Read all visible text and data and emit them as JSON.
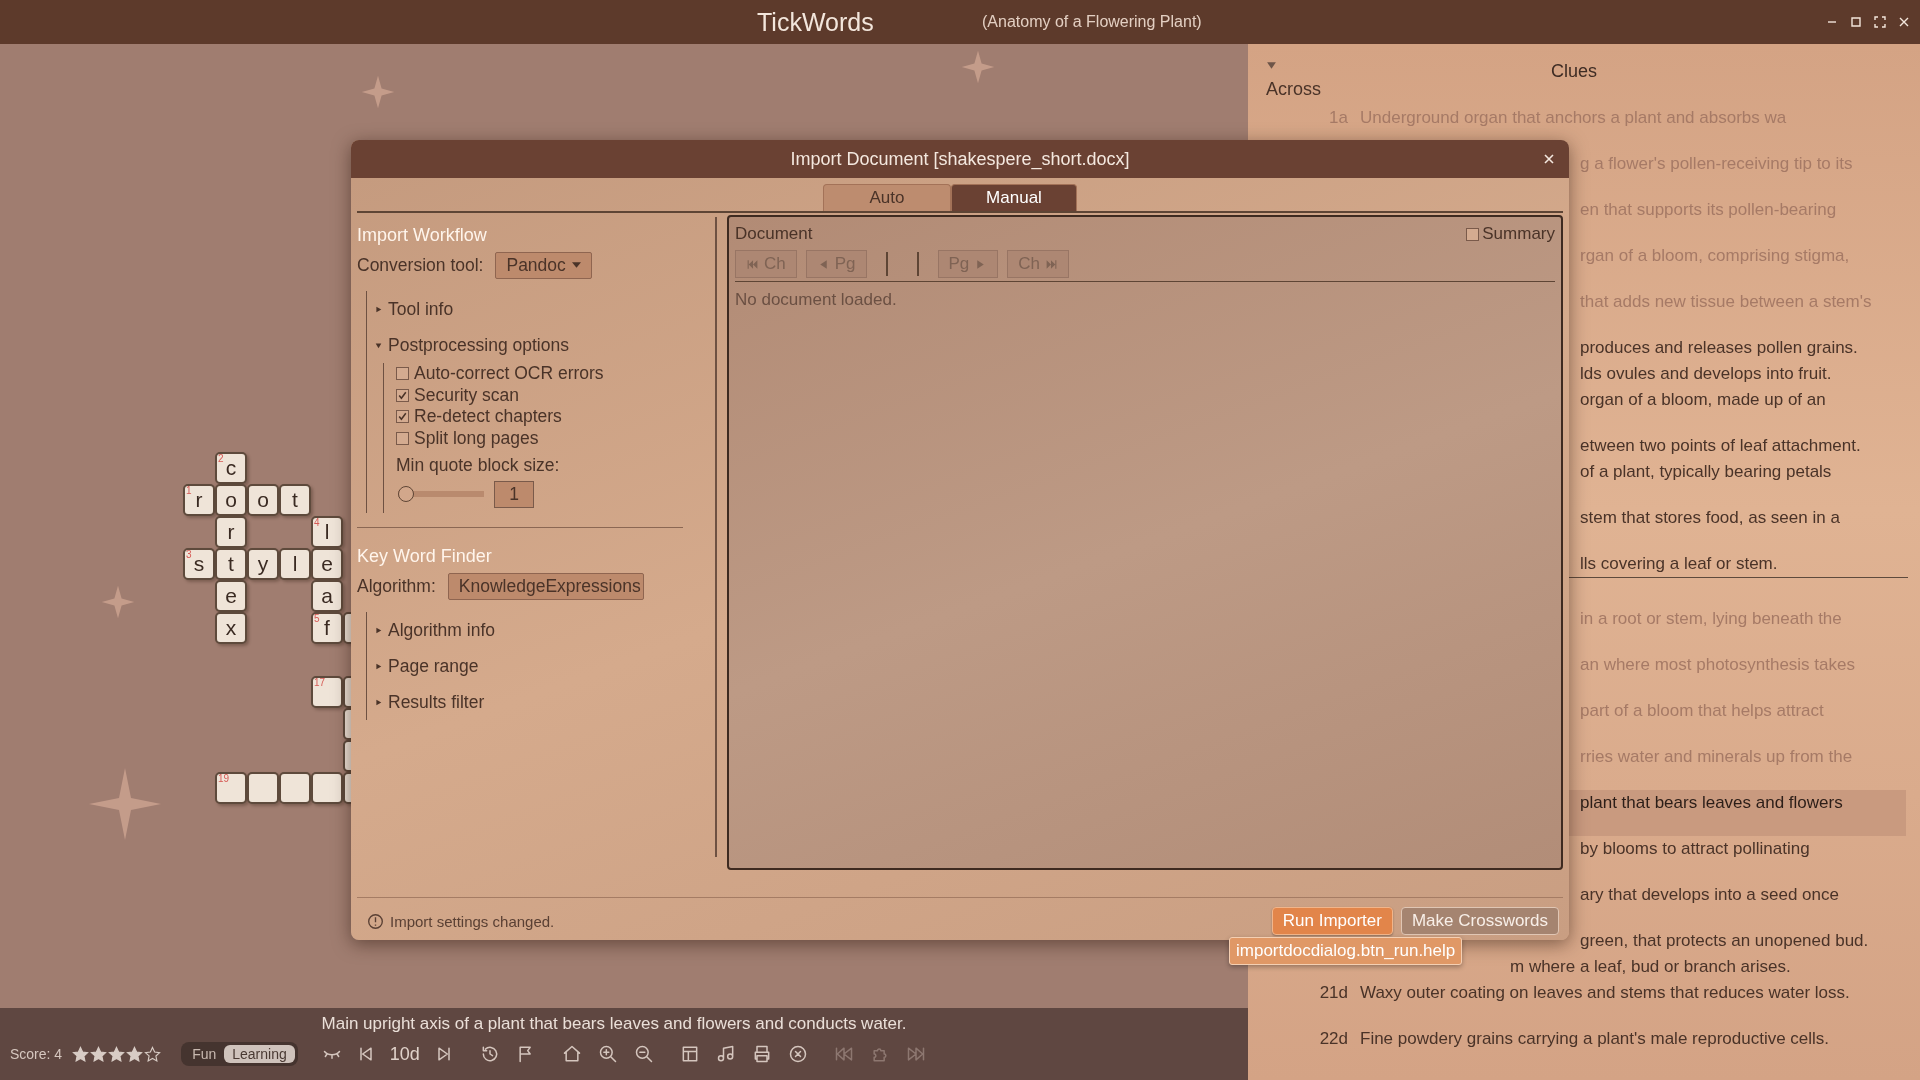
{
  "window": {
    "title": "TickWords",
    "subtitle": "(Anatomy of a Flowering Plant)"
  },
  "crossword": {
    "grid": [
      [
        {
          "kind": "void"
        },
        {
          "kind": "cell",
          "letter": "c",
          "number": "2"
        }
      ],
      [
        {
          "kind": "cell",
          "letter": "r",
          "number": "1"
        },
        {
          "kind": "cell",
          "letter": "o"
        },
        {
          "kind": "cell",
          "letter": "o"
        },
        {
          "kind": "cell",
          "letter": "t"
        }
      ],
      [
        {
          "kind": "void"
        },
        {
          "kind": "cell",
          "letter": "r"
        },
        {
          "kind": "void"
        },
        {
          "kind": "void"
        },
        {
          "kind": "cell",
          "letter": "l",
          "number": "4"
        }
      ],
      [
        {
          "kind": "cell",
          "letter": "s",
          "number": "3"
        },
        {
          "kind": "cell",
          "letter": "t"
        },
        {
          "kind": "cell",
          "letter": "y"
        },
        {
          "kind": "cell",
          "letter": "l"
        },
        {
          "kind": "cell",
          "letter": "e"
        }
      ],
      [
        {
          "kind": "void"
        },
        {
          "kind": "cell",
          "letter": "e"
        },
        {
          "kind": "void"
        },
        {
          "kind": "void"
        },
        {
          "kind": "cell",
          "letter": "a"
        }
      ],
      [
        {
          "kind": "void"
        },
        {
          "kind": "cell",
          "letter": "x"
        },
        {
          "kind": "void"
        },
        {
          "kind": "void"
        },
        {
          "kind": "cell",
          "letter": "f",
          "number": "5"
        },
        {
          "kind": "cell"
        }
      ],
      [
        {
          "kind": "void"
        }
      ],
      [
        {
          "kind": "void"
        },
        {
          "kind": "void"
        },
        {
          "kind": "void"
        },
        {
          "kind": "void"
        },
        {
          "kind": "cell",
          "number": "17"
        },
        {
          "kind": "cell"
        }
      ],
      [
        {
          "kind": "void"
        },
        {
          "kind": "void"
        },
        {
          "kind": "void"
        },
        {
          "kind": "void"
        },
        {
          "kind": "void"
        },
        {
          "kind": "cell"
        }
      ],
      [
        {
          "kind": "void"
        },
        {
          "kind": "void"
        },
        {
          "kind": "void"
        },
        {
          "kind": "void"
        },
        {
          "kind": "void"
        },
        {
          "kind": "cell"
        }
      ],
      [
        {
          "kind": "void"
        },
        {
          "kind": "cell",
          "number": "19"
        },
        {
          "kind": "cell"
        },
        {
          "kind": "cell"
        },
        {
          "kind": "cell"
        },
        {
          "kind": "cell"
        }
      ]
    ]
  },
  "bottom_bar": {
    "current_clue": "Main upright axis of a plant that bears leaves and flowers and conducts water.",
    "score": "Score: 4",
    "stars": 4,
    "modes": [
      {
        "label": "Fun",
        "selected": false
      },
      {
        "label": "Learning",
        "selected": true
      }
    ],
    "clue_number": "10d",
    "toolbar_groups": [
      [
        {
          "kind": "history",
          "disabled": false
        },
        {
          "kind": "flag",
          "disabled": false
        }
      ],
      [
        {
          "kind": "home",
          "disabled": false
        },
        {
          "kind": "zoom_in",
          "disabled": false
        },
        {
          "kind": "zoom_out",
          "disabled": false
        }
      ],
      [
        {
          "kind": "layout",
          "disabled": false
        },
        {
          "kind": "music",
          "disabled": false
        },
        {
          "kind": "print",
          "disabled": false
        },
        {
          "kind": "close_circle",
          "disabled": false
        }
      ],
      [
        {
          "kind": "rewind",
          "disabled": true
        },
        {
          "kind": "puzzle",
          "disabled": true
        },
        {
          "kind": "fast_forward",
          "disabled": true
        }
      ]
    ]
  },
  "clues": {
    "title": "Clues",
    "section": "Across",
    "expanded": true,
    "across": [
      {
        "number": "1a",
        "text": "Underground organ that anchors a plant and absorbs wa",
        "kind": "full",
        "wrapped": true,
        "solved": true,
        "selected": false
      },
      {
        "text": "g a flower's pollen-receiving tip to its",
        "kind": "behind_dialog",
        "wrapped": true,
        "solved": true,
        "selected": false
      },
      {
        "text": "en that supports its pollen-bearing",
        "kind": "behind_dialog",
        "wrapped": true,
        "solved": true,
        "selected": false
      },
      {
        "text": "rgan of a bloom, comprising stigma,",
        "kind": "behind_dialog",
        "wrapped": true,
        "solved": true,
        "selected": false
      },
      {
        "text": "that adds new tissue between a stem's",
        "kind": "behind_dialog",
        "wrapped": true,
        "solved": true,
        "selected": false
      },
      {
        "text": "produces and releases pollen grains.",
        "kind": "behind_dialog",
        "wrapped": false,
        "solved": false,
        "selected": false
      },
      {
        "text": "lds ovules and develops into fruit.",
        "kind": "behind_dialog",
        "wrapped": false,
        "solved": false,
        "selected": false
      },
      {
        "text": "organ of a bloom, made up of an",
        "kind": "behind_dialog",
        "wrapped": true,
        "solved": false,
        "selected": false
      },
      {
        "text": "etween two points of leaf attachment.",
        "kind": "behind_dialog",
        "wrapped": false,
        "solved": false,
        "selected": false
      },
      {
        "text": "of a plant, typically bearing petals",
        "kind": "behind_dialog",
        "wrapped": true,
        "solved": false,
        "selected": false
      },
      {
        "text": "stem that stores food, as seen in a",
        "kind": "behind_dialog",
        "wrapped": true,
        "solved": false,
        "selected": false
      },
      {
        "text": "lls covering a leaf or stem.",
        "kind": "behind_dialog",
        "wrapped": false,
        "solved": false,
        "selected": false
      }
    ],
    "down": [
      {
        "text": "in a root or stem, lying beneath the",
        "kind": "behind_dialog",
        "wrapped": true,
        "solved": true,
        "selected": false
      },
      {
        "text": "an where most photosynthesis takes",
        "kind": "behind_dialog",
        "wrapped": true,
        "solved": true,
        "selected": false
      },
      {
        "text": "part of a bloom that helps attract",
        "kind": "behind_dialog",
        "wrapped": true,
        "solved": true,
        "selected": false
      },
      {
        "text": "rries water and minerals up from the",
        "kind": "behind_dialog",
        "wrapped": true,
        "solved": true,
        "selected": false
      },
      {
        "text": "plant that bears leaves and flowers",
        "kind": "behind_dialog",
        "wrapped": true,
        "solved": false,
        "selected": true
      },
      {
        "text": "by blooms to attract pollinating",
        "kind": "behind_dialog",
        "wrapped": true,
        "solved": false,
        "selected": false
      },
      {
        "text": "ary that develops into a seed once",
        "kind": "behind_dialog",
        "wrapped": true,
        "solved": false,
        "selected": false
      },
      {
        "text": "green, that protects an unopened bud.",
        "kind": "behind_dialog",
        "wrapped": false,
        "solved": false,
        "selected": false
      },
      {
        "text": "m where a leaf, bud or branch arises.",
        "kind": "behind_tooltip",
        "wrapped": false,
        "solved": false,
        "selected": false
      },
      {
        "number": "21d",
        "text": "Waxy outer coating on leaves and stems that reduces water loss.",
        "kind": "full",
        "wrapped": true,
        "solved": false,
        "selected": false
      },
      {
        "number": "22d",
        "text": "Fine powdery grains carrying a plant's male reproductive cells.",
        "kind": "full",
        "wrapped": true,
        "solved": false,
        "selected": false
      }
    ]
  },
  "dialog": {
    "title": "Import Document [shakespere_short.docx]",
    "tabs": [
      {
        "label": "Auto",
        "selected": false
      },
      {
        "label": "Manual",
        "selected": true
      }
    ],
    "workflow": {
      "title": "Import Workflow",
      "conversion_label": "Conversion tool:",
      "conversion_value": "Pandoc",
      "sections": [
        {
          "label": "Tool info",
          "expanded": false
        },
        {
          "label": "Postprocessing options",
          "expanded": true,
          "options": [
            {
              "label": "Auto-correct OCR errors",
              "checked": false
            },
            {
              "label": "Security scan",
              "checked": true
            },
            {
              "label": "Re-detect chapters",
              "checked": true
            },
            {
              "label": "Split long pages",
              "checked": false
            }
          ],
          "slider": {
            "label": "Min quote block size:",
            "level": 0,
            "value": "1"
          }
        }
      ]
    },
    "keyword_finder": {
      "title": "Key Word Finder",
      "algorithm_label": "Algorithm:",
      "algorithm_value": "KnowledgeExpressions",
      "sections": [
        {
          "label": "Algorithm info",
          "expanded": false
        },
        {
          "label": "Page range",
          "expanded": false
        },
        {
          "label": "Results filter",
          "expanded": false
        }
      ]
    },
    "document": {
      "title": "Document",
      "summary": {
        "label": "Summary",
        "checked": false
      },
      "nav": [
        {
          "label": "Ch",
          "kind": "first_chapter",
          "disabled": true
        },
        {
          "label": "Pg",
          "kind": "prev_page",
          "disabled": true
        },
        {
          "label": "Pg",
          "kind": "next_page",
          "disabled": true
        },
        {
          "label": "Ch",
          "kind": "last_chapter",
          "disabled": true
        }
      ],
      "message": "No document loaded."
    },
    "status": "Import settings changed.",
    "buttons": [
      {
        "label": "Run Importer",
        "kind": "primary"
      },
      {
        "label": "Make Crosswords",
        "kind": "secondary"
      }
    ],
    "tooltip": "importdocdialog.btn_run.help"
  }
}
